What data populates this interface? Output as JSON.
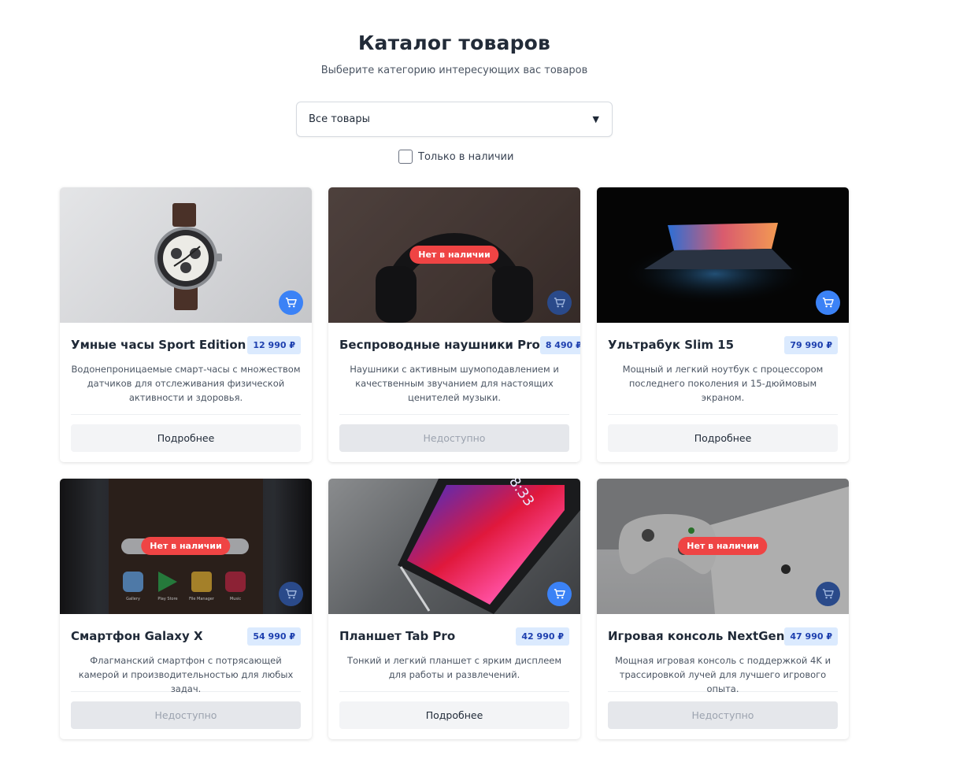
{
  "page": {
    "title": "Каталог товаров",
    "subtitle": "Выберите категорию интересующих вас товаров"
  },
  "filter": {
    "category_value": "Все товары",
    "stock_label": "Только в наличии",
    "stock_checked": false
  },
  "labels": {
    "out_of_stock": "Нет в наличии",
    "details": "Подробнее",
    "unavailable": "Недоступно"
  },
  "icons": {
    "cart": "cart-icon",
    "dropdown": "chevron-down-icon"
  },
  "colors": {
    "accent": "#3b82f6",
    "danger": "#ef4444",
    "price_bg": "#dbeafe",
    "price_text": "#1e40af"
  },
  "products": [
    {
      "name": "Умные часы Sport Edition",
      "price": "12 990 ₽",
      "description": "Водонепроницаемые смарт-часы с множеством датчиков для отслеживания физической активности и здоровья.",
      "in_stock": true,
      "button": "Подробнее",
      "image": "watch"
    },
    {
      "name": "Беспроводные наушники Pro",
      "price": "8 490 ₽",
      "description": "Наушники с активным шумоподавлением и качественным звучанием для настоящих ценителей музыки.",
      "in_stock": false,
      "badge": "Нет в наличии",
      "button": "Недоступно",
      "image": "headphones"
    },
    {
      "name": "Ультрабук Slim 15",
      "price": "79 990 ₽",
      "description": "Мощный и легкий ноутбук с процессором последнего поколения и 15-дюймовым экраном.",
      "in_stock": true,
      "button": "Подробнее",
      "image": "laptop"
    },
    {
      "name": "Смартфон Galaxy X",
      "price": "54 990 ₽",
      "description": "Флагманский смартфон с потрясающей камерой и производительностью для любых задач.",
      "in_stock": false,
      "badge": "Нет в наличии",
      "button": "Недоступно",
      "image": "phone"
    },
    {
      "name": "Планшет Tab Pro",
      "price": "42 990 ₽",
      "description": "Тонкий и легкий планшет с ярким дисплеем для работы и развлечений.",
      "in_stock": true,
      "button": "Подробнее",
      "image": "tablet"
    },
    {
      "name": "Игровая консоль NextGen",
      "price": "47 990 ₽",
      "description": "Мощная игровая консоль с поддержкой 4K и трассировкой лучей для лучшего игрового опыта.",
      "in_stock": false,
      "badge": "Нет в наличии",
      "button": "Недоступно",
      "image": "console"
    }
  ],
  "phone_screen": {
    "apps": [
      "Gallery",
      "Play Store",
      "File Manager",
      "Music"
    ]
  },
  "tablet_screen": {
    "clock": "8:33"
  }
}
